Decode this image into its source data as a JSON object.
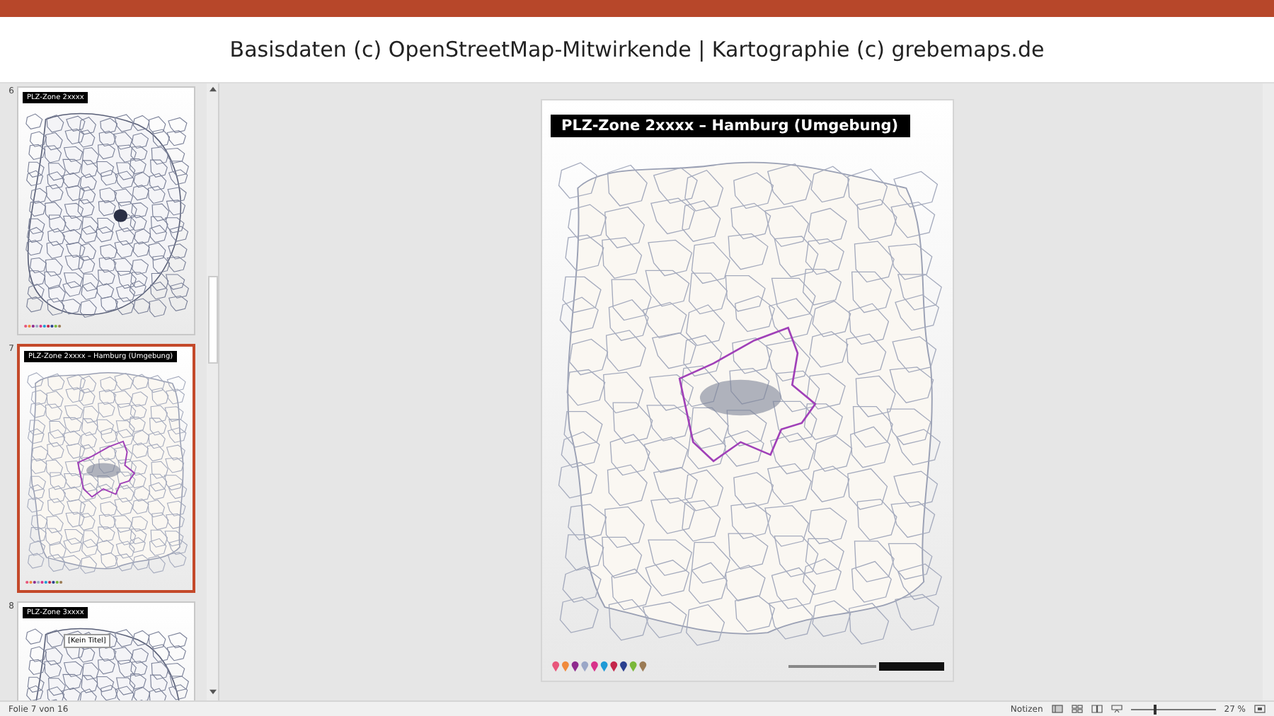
{
  "banner": {
    "text": "Basisdaten (c) OpenStreetMap-Mitwirkende | Kartographie (c) grebemaps.de"
  },
  "thumbnails": [
    {
      "number": "6",
      "title": "PLZ-Zone 2xxxx",
      "selected": false,
      "kind": "region"
    },
    {
      "number": "7",
      "title": "PLZ-Zone 2xxxx – Hamburg (Umgebung)",
      "selected": true,
      "kind": "city"
    },
    {
      "number": "8",
      "title": "PLZ-Zone 3xxxx",
      "selected": false,
      "kind": "region",
      "tooltip": "[Kein Titel]"
    }
  ],
  "slide": {
    "title": "PLZ-Zone 2xxxx – Hamburg (Umgebung)"
  },
  "status_bar": {
    "slide_counter": "Folie 7 von 16",
    "notes": "Notizen",
    "zoom": "27 %",
    "zoom_slider": {
      "level": 0.27
    }
  }
}
